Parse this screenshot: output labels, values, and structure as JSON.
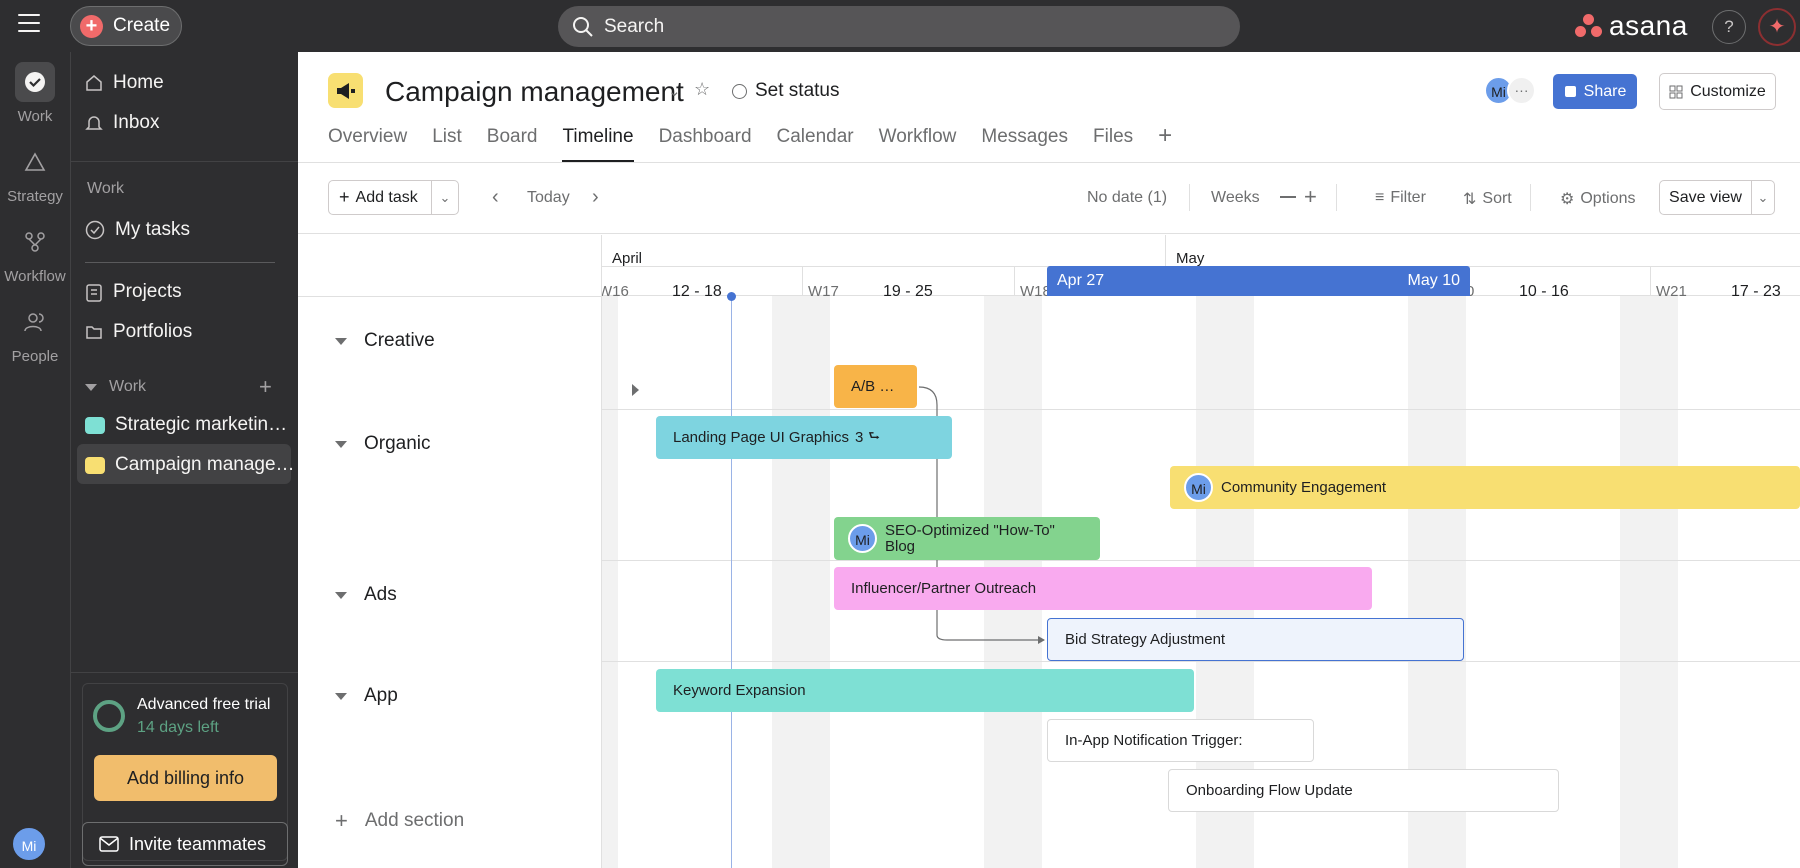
{
  "topbar": {
    "create_label": "Create",
    "search_placeholder": "Search",
    "logo_text": "asana",
    "help_label": "?"
  },
  "rail": {
    "items": [
      {
        "label": "Work",
        "icon": "check-circle-icon"
      },
      {
        "label": "Strategy",
        "icon": "triangle-icon"
      },
      {
        "label": "Workflow",
        "icon": "workflow-icon"
      },
      {
        "label": "People",
        "icon": "people-icon"
      }
    ],
    "avatar": "Mi"
  },
  "sidebar": {
    "home": "Home",
    "inbox": "Inbox",
    "work_header": "Work",
    "my_tasks": "My tasks",
    "projects": "Projects",
    "portfolios": "Portfolios",
    "work_section": "Work",
    "projects_list": [
      {
        "label": "Strategic marketin…",
        "color": "#7ee0d4"
      },
      {
        "label": "Campaign manage…",
        "color": "#f8df72"
      }
    ],
    "trial_title": "Advanced free trial",
    "trial_days": "14 days left",
    "billing_label": "Add billing info",
    "invite_label": "Invite teammates"
  },
  "project": {
    "title": "Campaign management",
    "set_status": "Set status",
    "avatar": "Mi",
    "share_label": "Share",
    "customize_label": "Customize",
    "tabs": [
      "Overview",
      "List",
      "Board",
      "Timeline",
      "Dashboard",
      "Calendar",
      "Workflow",
      "Messages",
      "Files"
    ],
    "active_tab": "Timeline"
  },
  "toolbar": {
    "add_task": "Add task",
    "today": "Today",
    "no_date": "No date (1)",
    "weeks": "Weeks",
    "filter": "Filter",
    "sort": "Sort",
    "options": "Options",
    "save_view": "Save view"
  },
  "timeline": {
    "months": [
      "April",
      "May"
    ],
    "weeks": [
      "W16",
      "12 - 18",
      "W17",
      "19 - 25",
      "W18",
      "0",
      "10 - 16",
      "W21",
      "17 - 23"
    ],
    "selected_start": "Apr 27",
    "selected_end": "May 10",
    "sections": [
      "Creative",
      "Organic",
      "Ads",
      "App"
    ],
    "add_section": "Add section",
    "tasks": {
      "ab": "A/B …",
      "landing": "Landing Page UI Graphics",
      "landing_subtasks": "3",
      "community": "Community Engagement",
      "seo": "SEO-Optimized \"How-To\" Blog",
      "influencer": "Influencer/Partner Outreach",
      "bid": "Bid Strategy Adjustment",
      "keyword": "Keyword Expansion",
      "inapp": "In-App Notification Trigger:",
      "onboarding": "Onboarding Flow Update"
    },
    "assignee": "Mi"
  },
  "colors": {
    "orange": "#f8b448",
    "teal": "#7ed4e0",
    "yellow": "#f8df72",
    "green": "#83d38e",
    "pink": "#f9aaef",
    "mint": "#7ee0d4",
    "blue_outline": "#4573d2",
    "accent": "#4573d2"
  }
}
